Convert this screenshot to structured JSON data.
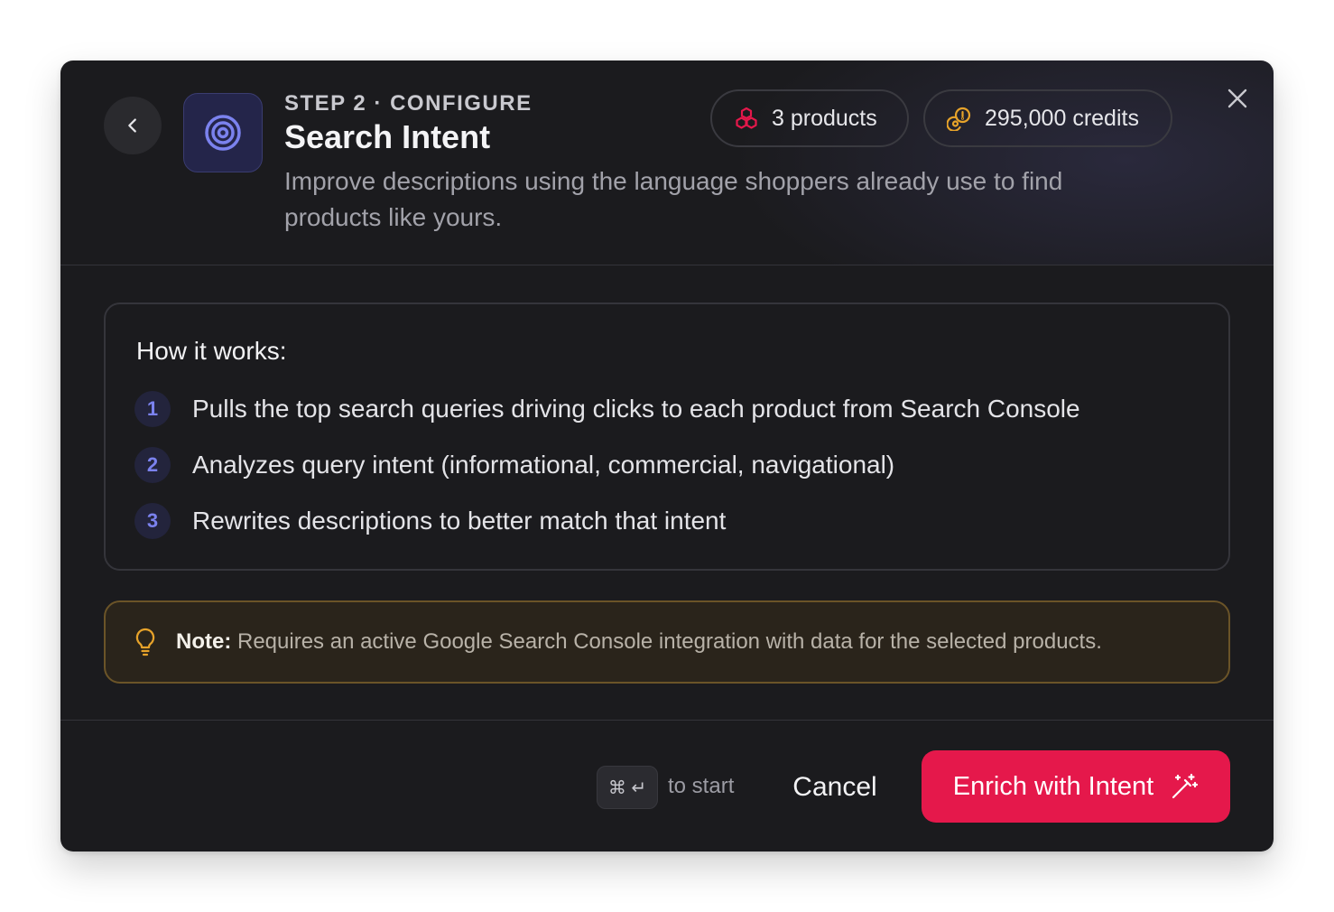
{
  "header": {
    "step_label": "STEP 2 · CONFIGURE",
    "title": "Search Intent",
    "description": "Improve descriptions using the language shoppers already use to find products like yours.",
    "products_pill": "3 products",
    "credits_pill": "295,000 credits",
    "icons": {
      "back": "chevron-left-icon",
      "app": "target-icon",
      "products": "cubes-icon",
      "credits": "coins-icon",
      "close": "close-icon"
    }
  },
  "how_it_works": {
    "title": "How it works:",
    "steps": [
      {
        "num": "1",
        "text": "Pulls the top search queries driving clicks to each product from Search Console"
      },
      {
        "num": "2",
        "text": "Analyzes query intent (informational, commercial, navigational)"
      },
      {
        "num": "3",
        "text": "Rewrites descriptions to better match that intent"
      }
    ]
  },
  "note": {
    "label": "Note:",
    "text": "Requires an active Google Search Console integration with data for the selected products.",
    "icon": "lightbulb-icon"
  },
  "footer": {
    "shortcut_keys": "⌘ ↵",
    "shortcut_hint": "to start",
    "cancel_label": "Cancel",
    "primary_label": "Enrich with Intent",
    "primary_icon": "magic-wand-icon"
  },
  "colors": {
    "accent": "#e5184b",
    "step_number": "#7b82ee",
    "note_border": "#6b5428",
    "credits_icon": "#e7a32a",
    "products_icon": "#e5184b"
  }
}
